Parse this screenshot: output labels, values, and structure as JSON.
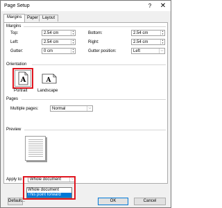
{
  "window": {
    "title": "Page Setup",
    "help": "?",
    "close": "✕"
  },
  "tabs": [
    {
      "label": "Margins"
    },
    {
      "label": "Paper"
    },
    {
      "label": "Layout"
    }
  ],
  "margins": {
    "section_label": "Margins",
    "top": {
      "label": "Top:",
      "value": "2.54 cm"
    },
    "bottom": {
      "label": "Bottom:",
      "value": "2.54 cm"
    },
    "left": {
      "label": "Left:",
      "value": "2.54 cm"
    },
    "right": {
      "label": "Right:",
      "value": "2.54 cm"
    },
    "gutter": {
      "label": "Gutter:",
      "value": "0 cm"
    },
    "gutter_position": {
      "label": "Gutter position:",
      "value": "Left"
    }
  },
  "orientation": {
    "section_label": "Orientation",
    "portrait": {
      "label": "Portrait",
      "glyph": "A"
    },
    "landscape": {
      "label": "Landscape",
      "glyph": "A"
    }
  },
  "pages": {
    "section_label": "Pages",
    "multiple_label": "Multiple pages:",
    "multiple_value": "Normal"
  },
  "preview": {
    "section_label": "Preview"
  },
  "apply_to": {
    "label": "Apply to:",
    "value": "Whole document",
    "options": [
      "Whole document",
      "This point forward"
    ],
    "selected_option_index": 1
  },
  "buttons": {
    "default": "Default...",
    "ok": "OK",
    "cancel": "Cancel"
  },
  "colors": {
    "highlight_red": "#e0141e",
    "selection_blue": "#0078d7"
  },
  "icons": {
    "spinner": "spin-arrows-icon",
    "dropdown": "chevron-down-icon"
  }
}
